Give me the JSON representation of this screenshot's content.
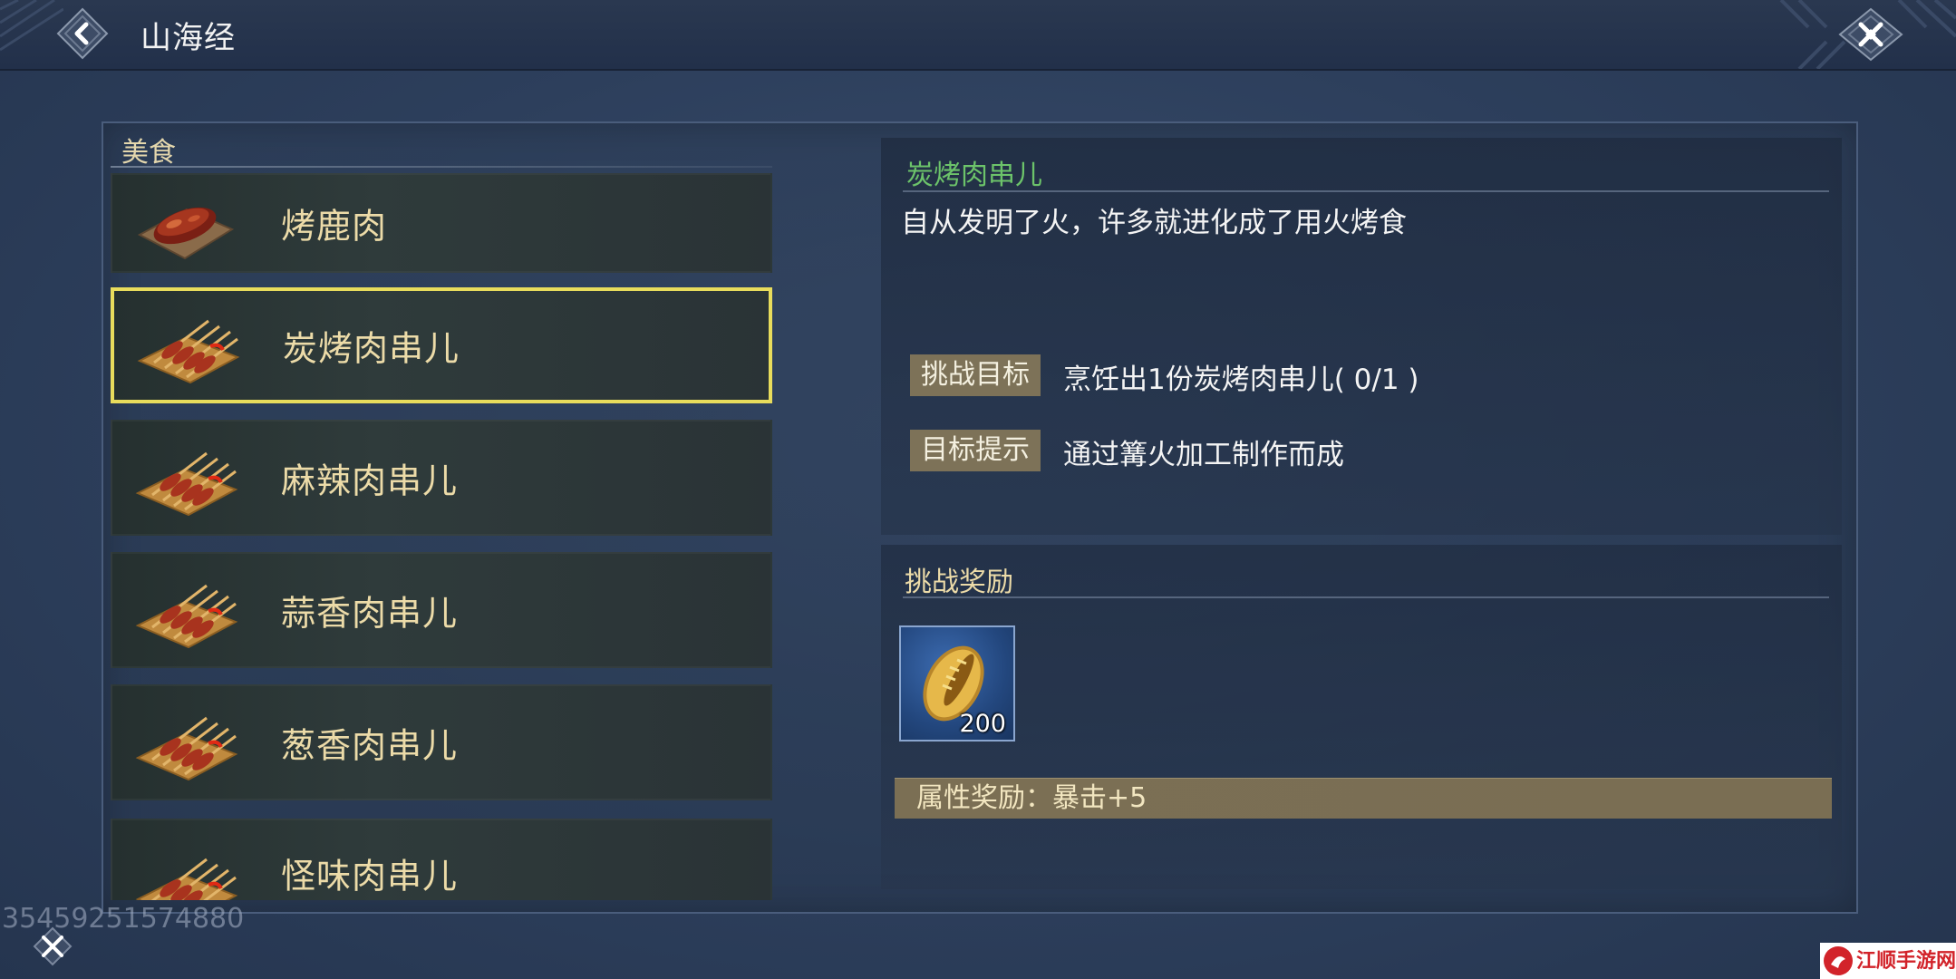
{
  "header": {
    "title": "山海经",
    "back_icon": "back-arrow-icon",
    "close_icon": "close-x-icon"
  },
  "list": {
    "header": "美食",
    "items": [
      {
        "label": "烤鹿肉",
        "icon": "roast-venison-icon",
        "selected": false
      },
      {
        "label": "炭烤肉串儿",
        "icon": "meat-skewer-icon",
        "selected": true
      },
      {
        "label": "麻辣肉串儿",
        "icon": "meat-skewer-icon",
        "selected": false
      },
      {
        "label": "蒜香肉串儿",
        "icon": "meat-skewer-icon",
        "selected": false
      },
      {
        "label": "葱香肉串儿",
        "icon": "meat-skewer-icon",
        "selected": false
      },
      {
        "label": "怪味肉串儿",
        "icon": "meat-skewer-icon",
        "selected": false
      }
    ]
  },
  "detail": {
    "title": "炭烤肉串儿",
    "description": "自从发明了火，许多就进化成了用火烤食",
    "goal_tag": "挑战目标",
    "goal_value": "烹饪出1份炭烤肉串儿( 0/1 )",
    "hint_tag": "目标提示",
    "hint_value": "通过篝火加工制作而成"
  },
  "reward": {
    "title": "挑战奖励",
    "item_icon": "gold-cowrie-shell-icon",
    "item_count": "200",
    "attribute": "属性奖励：暴击+5"
  },
  "footer": {
    "id_watermark": "35459251574880",
    "site_logo": "江顺手游网"
  },
  "colors": {
    "title_green": "#6cc36a",
    "label_gold": "#ecdba8",
    "selected_border": "#e8dc5c",
    "tag_bg": "#7d7258"
  }
}
